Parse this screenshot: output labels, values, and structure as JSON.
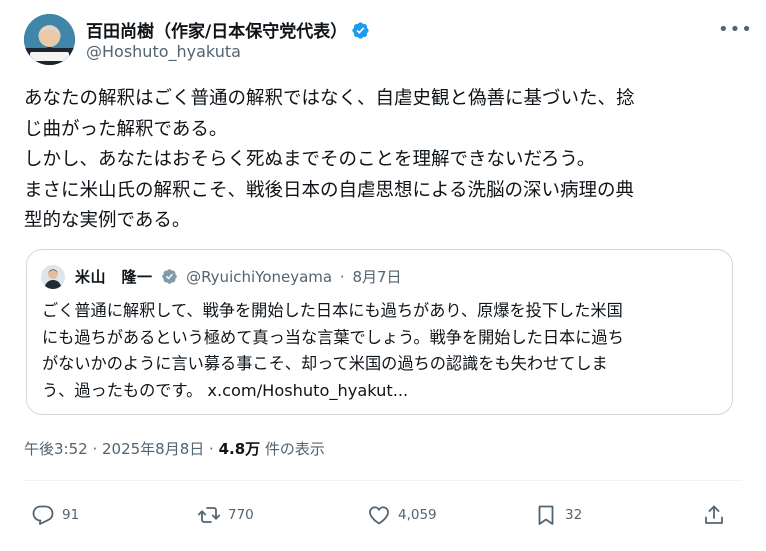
{
  "author": {
    "name": "百田尚樹（作家/日本保守党代表）",
    "handle": "@Hoshuto_hyakuta",
    "avatar_caption": "百田尚樹"
  },
  "icons": {
    "verified": "verified-badge-icon",
    "more": "more-options-icon",
    "reply": "reply-icon",
    "retweet": "retweet-icon",
    "like": "heart-icon",
    "bookmark": "bookmark-icon",
    "share": "share-icon"
  },
  "colors": {
    "verified": "#1d9bf0",
    "secondary_text": "#536471",
    "primary_text": "#0f1419",
    "border": "#cfd9de"
  },
  "tweet": {
    "lines": [
      "あなたの解釈はごく普通の解釈ではなく、自虐史観と偽善に基づいた、捻",
      "じ曲がった解釈である。",
      "しかし、あなたはおそらく死ぬまでそのことを理解できないだろう。",
      "まさに米山氏の解釈こそ、戦後日本の自虐思想による洗脳の深い病理の典",
      "型的な実例である。"
    ]
  },
  "quote": {
    "name": "米山　隆一",
    "handle": "@RyuichiYoneyama",
    "sep": "·",
    "date": "8月7日",
    "lines": [
      "ごく普通に解釈して、戦争を開始した日本にも過ちがあり、原爆を投下した米国",
      "にも過ちがあるという極めて真っ当な言葉でしょう。戦争を開始した日本に過ち",
      "がないかのように言い募る事こそ、却って米国の過ちの認識をも失わせてしま",
      "う、過ったものです。 x.com/Hoshuto_hyakut..."
    ]
  },
  "meta": {
    "time": "午後3:52",
    "sep1": " · ",
    "date": "2025年8月8日",
    "sep2": " · ",
    "views": "4.8万",
    "views_label": " 件の表示"
  },
  "actions": {
    "replies": "91",
    "retweets": "770",
    "likes": "4,059",
    "bookmarks": "32"
  }
}
